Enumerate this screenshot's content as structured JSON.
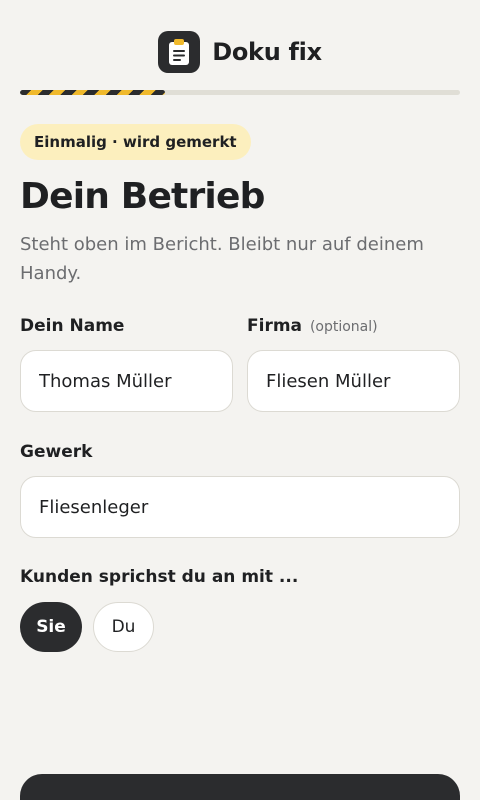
{
  "brand": {
    "name": "Doku fix",
    "logo_icon": "clipboard-icon",
    "accent": "#f0b92b"
  },
  "progress": {
    "value": 0.33
  },
  "badge": {
    "label": "Einmalig · wird gemerkt"
  },
  "page": {
    "title": "Dein Betrieb",
    "subtitle": "Steht oben im Bericht. Bleibt nur auf deinem Handy."
  },
  "form": {
    "name": {
      "label": "Dein Name",
      "value": "Thomas Müller"
    },
    "company": {
      "label": "Firma",
      "optional_hint": "(optional)",
      "value": "Fliesen Müller"
    },
    "trade": {
      "label": "Gewerk",
      "value": "Fliesenleger"
    },
    "address": {
      "label": "Kunden sprichst du an mit ...",
      "options": [
        "Sie",
        "Du"
      ],
      "selected": "Sie"
    }
  }
}
